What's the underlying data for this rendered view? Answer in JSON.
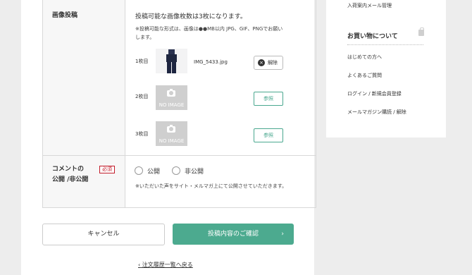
{
  "form": {
    "image_row_label": "画像投稿",
    "image_limit_text": "投稿可能な画像枚数は3枚になります。",
    "format_note": "※投稿可能な形式は、画像は●●MB以内 JPG、GIF、PNGでお願いします。",
    "images": [
      {
        "index_label": "1枚目",
        "filename": "IMG_5433.jpg",
        "action_label": "解除",
        "has_image": true
      },
      {
        "index_label": "2枚目",
        "no_image_label": "NO IMAGE",
        "action_label": "参照",
        "has_image": false
      },
      {
        "index_label": "3枚目",
        "no_image_label": "NO IMAGE",
        "action_label": "参照",
        "has_image": false
      }
    ],
    "comment_row_label_line1": "コメントの",
    "comment_row_label_line2": "公開 /非公開",
    "required_badge": "必須",
    "radio_public": "公開",
    "radio_private": "非公開",
    "comment_note": "※いただいた声をサイト・メルマガ上にて公開させていただきます。"
  },
  "actions": {
    "cancel_label": "キャンセル",
    "confirm_label": "投稿内容のご確認",
    "confirm_arrow": "›",
    "back_link": "注文履歴一覧へ戻る",
    "back_arrow": "‹"
  },
  "sidebar": {
    "top_item": "入荷案内メール管理",
    "section_title": "お買い物について",
    "items": [
      "はじめての方へ",
      "よくあるご質問",
      "ログイン / 新規会員登録",
      "メールマガジン購読 / 解除"
    ]
  },
  "colors": {
    "accent": "#4caa8f",
    "required": "#c21c2a",
    "background": "#ededed"
  },
  "icons": {
    "remove": "close-circle-icon",
    "camera": "camera-icon",
    "bag": "shopping-bag-icon",
    "chevron_right": "chevron-right-icon",
    "chevron_left": "chevron-left-icon"
  }
}
